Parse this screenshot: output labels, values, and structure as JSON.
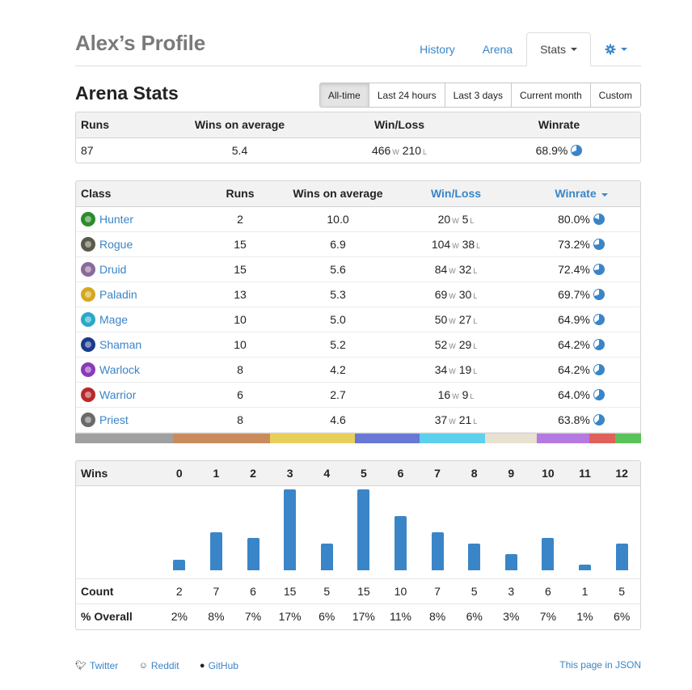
{
  "header": {
    "title": "Alex’s Profile",
    "nav": [
      {
        "label": "History",
        "active": false
      },
      {
        "label": "Arena",
        "active": false
      },
      {
        "label": "Stats",
        "active": true
      }
    ],
    "settings_icon": "gear-icon"
  },
  "arena": {
    "title": "Arena Stats",
    "ranges": [
      {
        "label": "All-time",
        "active": true
      },
      {
        "label": "Last 24 hours",
        "active": false
      },
      {
        "label": "Last 3 days",
        "active": false
      },
      {
        "label": "Current month",
        "active": false
      },
      {
        "label": "Custom",
        "active": false
      }
    ]
  },
  "summary": {
    "headers": {
      "runs": "Runs",
      "avg": "Wins on average",
      "wl": "Win/Loss",
      "winrate": "Winrate"
    },
    "runs": "87",
    "avg": "5.4",
    "wins": "466",
    "losses": "210",
    "winrate": "68.9%",
    "winrate_value": 68.9
  },
  "wl_suffix": {
    "w": "W",
    "l": "L"
  },
  "classes": {
    "headers": {
      "cls": "Class",
      "runs": "Runs",
      "avg": "Wins on average",
      "wl": "Win/Loss",
      "winrate": "Winrate"
    },
    "rows": [
      {
        "name": "Hunter",
        "icon": "hunter-icon",
        "color": "#2e8b2e",
        "runs": "2",
        "avg": "10.0",
        "wins": "20",
        "losses": "5",
        "winrate": "80.0%",
        "winrate_value": 80.0
      },
      {
        "name": "Rogue",
        "icon": "rogue-icon",
        "color": "#5a5a4a",
        "runs": "15",
        "avg": "6.9",
        "wins": "104",
        "losses": "38",
        "winrate": "73.2%",
        "winrate_value": 73.2
      },
      {
        "name": "Druid",
        "icon": "druid-icon",
        "color": "#8a6a9a",
        "runs": "15",
        "avg": "5.6",
        "wins": "84",
        "losses": "32",
        "winrate": "72.4%",
        "winrate_value": 72.4
      },
      {
        "name": "Paladin",
        "icon": "paladin-icon",
        "color": "#d4a820",
        "runs": "13",
        "avg": "5.3",
        "wins": "69",
        "losses": "30",
        "winrate": "69.7%",
        "winrate_value": 69.7
      },
      {
        "name": "Mage",
        "icon": "mage-icon",
        "color": "#2aa8c8",
        "runs": "10",
        "avg": "5.0",
        "wins": "50",
        "losses": "27",
        "winrate": "64.9%",
        "winrate_value": 64.9
      },
      {
        "name": "Shaman",
        "icon": "shaman-icon",
        "color": "#1a3a8a",
        "runs": "10",
        "avg": "5.2",
        "wins": "52",
        "losses": "29",
        "winrate": "64.2%",
        "winrate_value": 64.2
      },
      {
        "name": "Warlock",
        "icon": "warlock-icon",
        "color": "#8a3ab8",
        "runs": "8",
        "avg": "4.2",
        "wins": "34",
        "losses": "19",
        "winrate": "64.2%",
        "winrate_value": 64.2
      },
      {
        "name": "Warrior",
        "icon": "warrior-icon",
        "color": "#b82a2a",
        "runs": "6",
        "avg": "2.7",
        "wins": "16",
        "losses": "9",
        "winrate": "64.0%",
        "winrate_value": 64.0
      },
      {
        "name": "Priest",
        "icon": "priest-icon",
        "color": "#6a6a6a",
        "runs": "8",
        "avg": "4.6",
        "wins": "37",
        "losses": "21",
        "winrate": "63.8%",
        "winrate_value": 63.8
      }
    ],
    "distribution": [
      {
        "color": "#a0a0a0",
        "runs": 15
      },
      {
        "color": "#c98b5c",
        "runs": 15
      },
      {
        "color": "#e8cf5a",
        "runs": 13
      },
      {
        "color": "#6878d4",
        "runs": 10
      },
      {
        "color": "#5cd0ec",
        "runs": 10
      },
      {
        "color": "#e8e0d0",
        "runs": 8
      },
      {
        "color": "#b57ae0",
        "runs": 8
      },
      {
        "color": "#e0605a",
        "runs": 4
      },
      {
        "color": "#5ac25a",
        "runs": 4
      }
    ]
  },
  "wins_table": {
    "labels": {
      "wins": "Wins",
      "count": "Count",
      "overall": "% Overall"
    },
    "wins": [
      "0",
      "1",
      "2",
      "3",
      "4",
      "5",
      "6",
      "7",
      "8",
      "9",
      "10",
      "11",
      "12"
    ],
    "counts": [
      "2",
      "7",
      "6",
      "15",
      "5",
      "15",
      "10",
      "7",
      "5",
      "3",
      "6",
      "1",
      "5"
    ],
    "percents": [
      "2%",
      "8%",
      "7%",
      "17%",
      "6%",
      "17%",
      "11%",
      "8%",
      "6%",
      "3%",
      "7%",
      "1%",
      "6%"
    ]
  },
  "chart_data": {
    "type": "bar",
    "categories": [
      "0",
      "1",
      "2",
      "3",
      "4",
      "5",
      "6",
      "7",
      "8",
      "9",
      "10",
      "11",
      "12"
    ],
    "values": [
      2,
      7,
      6,
      15,
      5,
      15,
      10,
      7,
      5,
      3,
      6,
      1,
      5
    ],
    "title": "",
    "xlabel": "Wins",
    "ylabel": "Count",
    "ylim": [
      0,
      15
    ]
  },
  "colors": {
    "accent": "#3a85c7",
    "bar": "#3a85c7",
    "pie": "#3a85c7"
  },
  "footer": {
    "twitter": "Twitter",
    "reddit": "Reddit",
    "github": "GitHub",
    "json": "This page in JSON"
  }
}
